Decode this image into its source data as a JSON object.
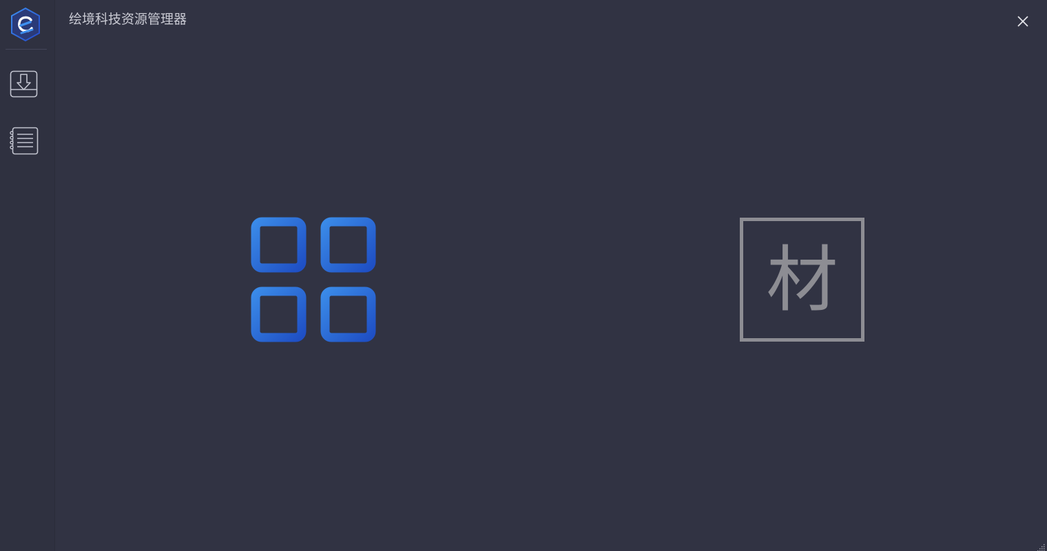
{
  "app": {
    "title": "绘境科技资源管理器"
  },
  "sidebar": {
    "logo_icon": "e-hexagon-logo-icon",
    "items": [
      {
        "name": "download",
        "icon": "download-box-icon"
      },
      {
        "name": "log",
        "icon": "notebook-list-icon"
      }
    ]
  },
  "main": {
    "tiles": [
      {
        "name": "apps",
        "icon": "four-squares-grid-icon",
        "colors": [
          "#3a8ae8",
          "#1f4fc4"
        ]
      },
      {
        "name": "material",
        "icon": "material-char-icon",
        "char": "材",
        "color": "#8d8d93"
      }
    ]
  },
  "window_controls": {
    "close_icon": "close-icon"
  },
  "colors": {
    "background": "#313343",
    "sidebar_background": "#2f3140",
    "text": "#c9cad3",
    "accent_blue": "#2f72dc",
    "muted_gray": "#8d8d93"
  }
}
